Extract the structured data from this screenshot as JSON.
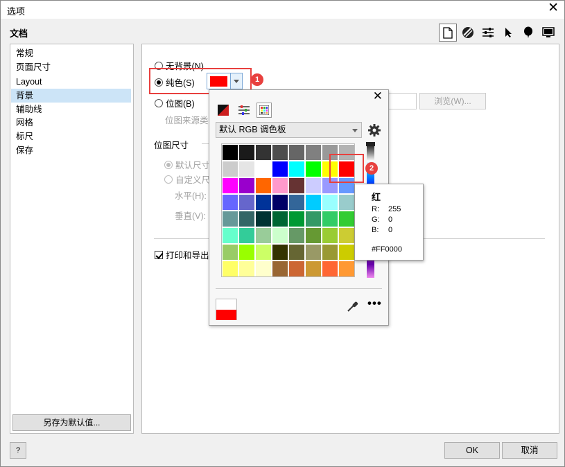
{
  "window": {
    "title": "选项",
    "close_glyph": "✕"
  },
  "header": {
    "section_title": "文档"
  },
  "toolbar_icons": [
    "document-icon",
    "globe-icon",
    "sliders-icon",
    "pointer-icon",
    "balloon-icon",
    "monitor-icon"
  ],
  "sidebar": {
    "items": [
      {
        "label": "常规"
      },
      {
        "label": "页面尺寸"
      },
      {
        "label": "Layout"
      },
      {
        "label": "背景"
      },
      {
        "label": "辅助线"
      },
      {
        "label": "网格"
      },
      {
        "label": "标尺"
      },
      {
        "label": "保存"
      }
    ],
    "selected": "背景",
    "save_default_label": "另存为默认值..."
  },
  "background": {
    "no_bg_label": "无背景(N)",
    "solid_label": "纯色(S)",
    "bitmap_label": "位图(B)",
    "bitmap_source_label": "位图来源类",
    "browse_label": "浏览(W)...",
    "solid_color": "#FF0000",
    "bitmap_size_label": "位图尺寸",
    "default_size_label": "默认尺寸",
    "custom_size_label": "自定义尺",
    "horizontal_label": "水平(H):",
    "vertical_label": "垂直(V):",
    "print_export_label": "打印和导出"
  },
  "annotations": {
    "badge1": "1",
    "badge2": "2"
  },
  "color_popup": {
    "close_glyph": "✕",
    "palette_name": "默认 RGB 调色板",
    "swatches": [
      [
        "#000000",
        "#1a1a1a",
        "#333333",
        "#4d4d4d",
        "#666666",
        "#808080",
        "#999999",
        "#b3b3b3"
      ],
      [
        "#cccccc",
        "#e5e5e5",
        "#ffffff",
        "#0000ff",
        "#00ffff",
        "#00ff00",
        "#ffff00",
        "#ff0000"
      ],
      [
        "#ff00ff",
        "#9900cc",
        "#ff6600",
        "#ff99cc",
        "#663333",
        "#ccccff",
        "#9999ff",
        "#6699ff"
      ],
      [
        "#6666ff",
        "#6666cc",
        "#003399",
        "#000066",
        "#336699",
        "#00ccff",
        "#99ffff",
        "#99cccc"
      ],
      [
        "#669999",
        "#336666",
        "#003333",
        "#006633",
        "#009933",
        "#339966",
        "#33cc66",
        "#33cc33"
      ],
      [
        "#66ffcc",
        "#33cc99",
        "#99cc99",
        "#ccffcc",
        "#669966",
        "#669933",
        "#99cc33",
        "#cccc33"
      ],
      [
        "#99cc66",
        "#99ff00",
        "#ccff66",
        "#333300",
        "#666633",
        "#999966",
        "#999933",
        "#cccc00"
      ],
      [
        "#ffff66",
        "#ffff99",
        "#ffffcc",
        "#996633",
        "#cc6633",
        "#cc9933",
        "#ff6633",
        "#ff9933"
      ]
    ]
  },
  "tooltip": {
    "name": "红",
    "r_label": "R:",
    "r_value": "255",
    "g_label": "G:",
    "g_value": "0",
    "b_label": "B:",
    "b_value": "0",
    "hex": "#FF0000"
  },
  "footer": {
    "help_label": "?",
    "ok_label": "OK",
    "cancel_label": "取消"
  }
}
